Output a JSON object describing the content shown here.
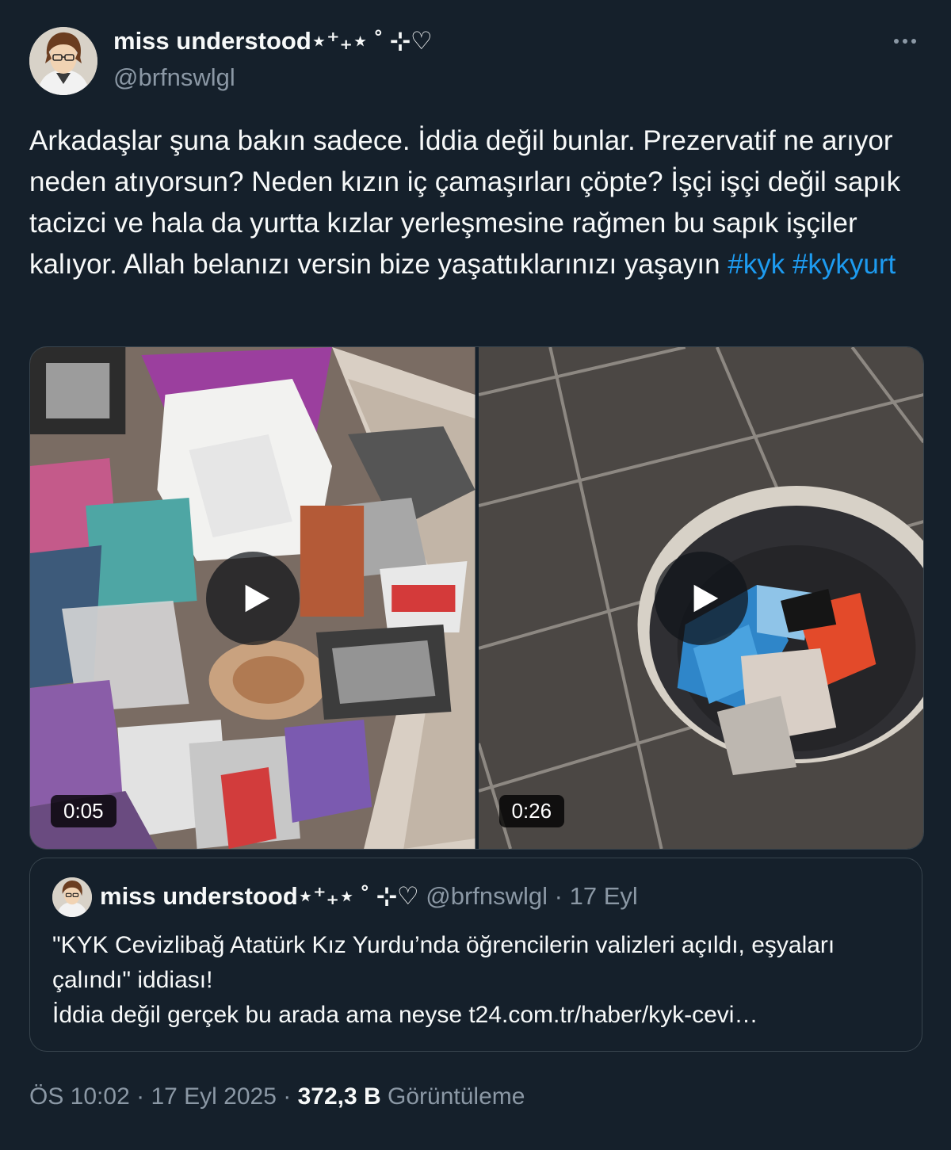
{
  "author": {
    "display_name": "miss understood⋆⁺₊⋆ ˚ ⊹♡",
    "handle": "@brfnswlgl"
  },
  "tweet": {
    "text_main": "Arkadaşlar şuna bakın sadece. İddia değil bunlar. Prezervatif ne arıyor neden atıyorsun? Neden kızın iç çamaşırları çöpte? İşçi işçi değil sapık tacizci ve hala da yurtta kızlar yerleşmesine rağmen bu sapık işçiler kalıyor. Allah belanızı versin bize yaşattıklarınızı yaşayın",
    "hashtags": [
      "#kyk",
      "#kykyurt"
    ]
  },
  "media": [
    {
      "type": "video",
      "duration": "0:05"
    },
    {
      "type": "video",
      "duration": "0:26"
    }
  ],
  "quoted_tweet": {
    "display_name": "miss understood⋆⁺₊⋆ ˚ ⊹♡",
    "handle": "@brfnswlgl",
    "separator": "·",
    "date": "17 Eyl",
    "line1": "\"KYK Cevizlibağ Atatürk Kız Yurdu’nda öğrencilerin valizleri açıldı, eşyaları çalındı\" iddiası!",
    "line2": "İddia değil gerçek bu arada ama neyse t24.com.tr/haber/kyk-cevi…"
  },
  "footer": {
    "time": "ÖS 10:02",
    "separator": "·",
    "date": "17 Eyl 2025",
    "views_count": "372,3 B",
    "views_label": "Görüntüleme"
  },
  "colors": {
    "background": "#15202b",
    "text": "#f7f9f9",
    "secondary": "#8b98a5",
    "accent": "#1d9bf0",
    "border": "#38444d"
  },
  "icons": {
    "more": "more-horizontal-icon",
    "play": "play-icon"
  }
}
